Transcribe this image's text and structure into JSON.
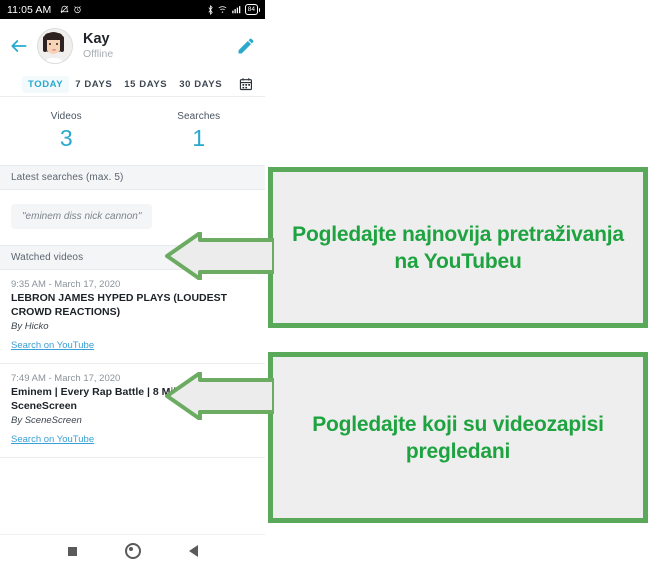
{
  "phone": {
    "status_bar": {
      "clock": "11:05 AM",
      "left_icons": [
        "mute-icon",
        "alarm-icon"
      ],
      "right_icons": [
        "bluetooth-icon",
        "wifi-icon",
        "signal-icon"
      ],
      "battery_level": "84"
    },
    "app_bar": {
      "back_icon": "back-arrow-icon",
      "avatar": "user-avatar",
      "profile_name": "Kay",
      "profile_status": "Offline",
      "edit_icon": "edit-pencil-icon"
    },
    "tabs": {
      "items": [
        {
          "label": "TODAY",
          "active": true
        },
        {
          "label": "7 DAYS",
          "active": false
        },
        {
          "label": "15 DAYS",
          "active": false
        },
        {
          "label": "30 DAYS",
          "active": false
        }
      ],
      "calendar_icon": "calendar-icon"
    },
    "stats": [
      {
        "label": "Videos",
        "value": "3"
      },
      {
        "label": "Searches",
        "value": "1"
      }
    ],
    "searches_section": {
      "header": "Latest searches (max. 5)",
      "items": [
        {
          "text": "\"eminem diss nick cannon\""
        }
      ]
    },
    "videos_section": {
      "header": "Watched videos",
      "items": [
        {
          "time": "9:35 AM - March 17, 2020",
          "title": "LEBRON JAMES HYPED PLAYS (LOUDEST CROWD REACTIONS)",
          "author": "By Hicko",
          "link": "Search on YouTube"
        },
        {
          "time": "7:49 AM - March 17, 2020",
          "title": "Eminem | Every Rap Battle | 8 Mile | SceneScreen",
          "author": "By SceneScreen",
          "link": "Search on YouTube"
        }
      ]
    },
    "nav_bar": {
      "recents": "recents-square-icon",
      "home": "home-circle-icon",
      "back": "back-triangle-icon"
    }
  },
  "annotations": {
    "callouts": [
      {
        "text": "Pogledajte najnovija pretraživanja na YouTubeu"
      },
      {
        "text": "Pogledajte koji su videozapisi pregledani"
      }
    ],
    "arrows": [
      {
        "direction": "left"
      },
      {
        "direction": "left"
      }
    ]
  },
  "colors": {
    "accent": "#29a8cc",
    "annotation_green_text": "#1ea340",
    "annotation_green_border": "#5aa85a",
    "annotation_fill": "#eeeeee",
    "link": "#3a9fd4"
  }
}
